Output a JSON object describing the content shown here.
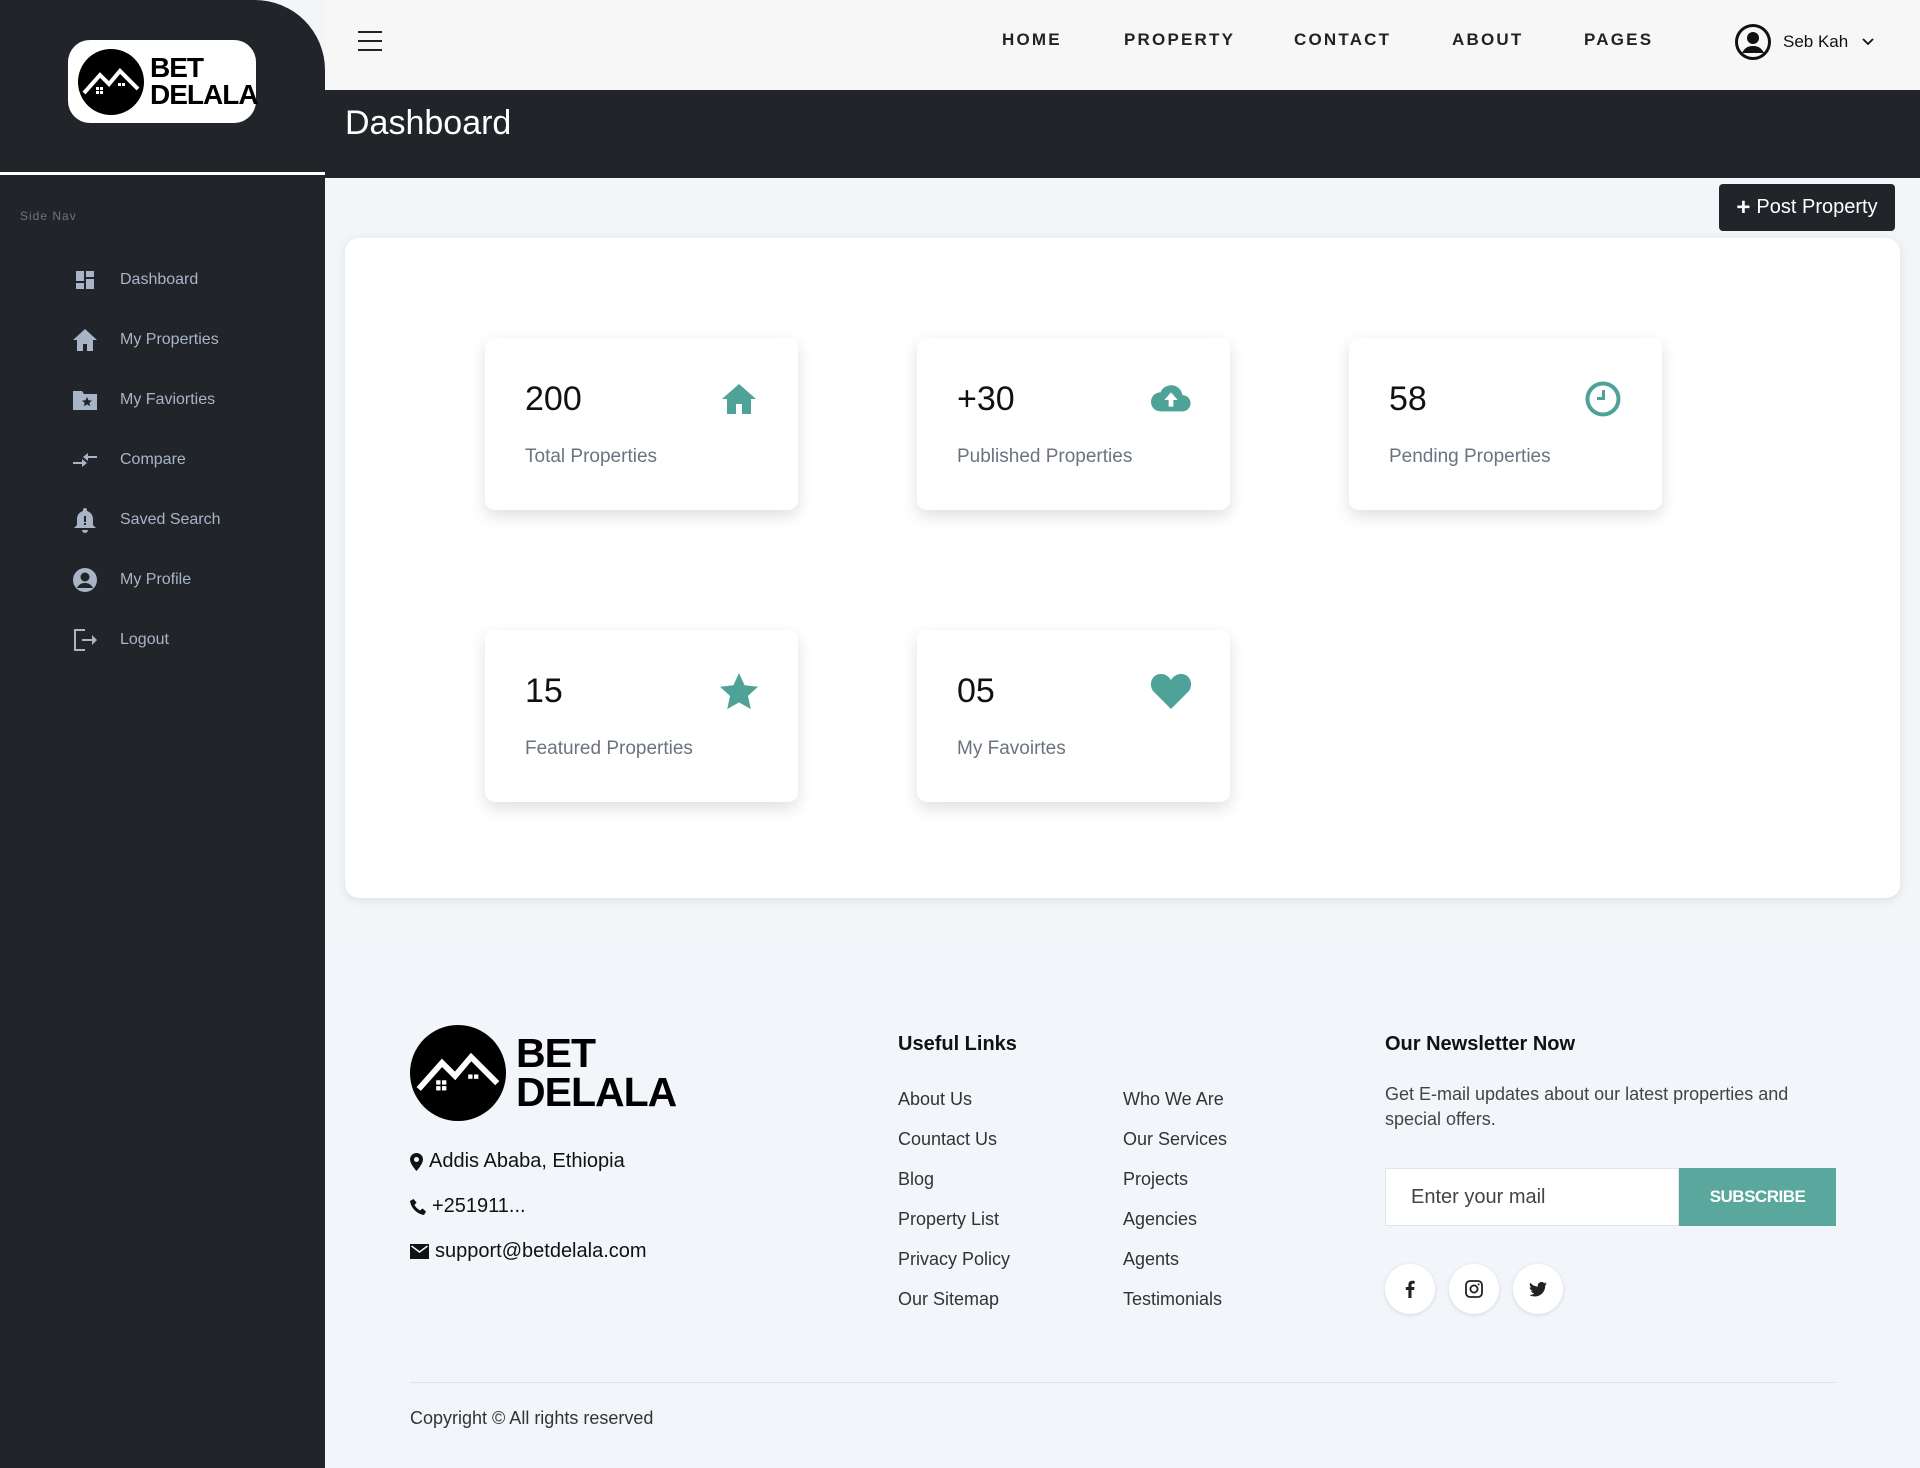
{
  "brand": {
    "line1": "BET",
    "line2": "DELALA"
  },
  "sidebar": {
    "section_label": "Side Nav",
    "items": [
      {
        "label": "Dashboard",
        "icon": "dashboard-icon"
      },
      {
        "label": "My Properties",
        "icon": "home-icon"
      },
      {
        "label": "My Faviorties",
        "icon": "favorite-folder-icon"
      },
      {
        "label": "Compare",
        "icon": "compare-arrows-icon"
      },
      {
        "label": "Saved Search",
        "icon": "bell-icon"
      },
      {
        "label": "My Profile",
        "icon": "user-circle-icon"
      },
      {
        "label": "Logout",
        "icon": "logout-icon"
      }
    ]
  },
  "topnav": {
    "links": [
      "HOME",
      "PROPERTY",
      "CONTACT",
      "ABOUT",
      "PAGES"
    ],
    "user_name": "Seb Kah"
  },
  "page": {
    "title": "Dashboard",
    "post_button": "Post Property"
  },
  "stats": [
    {
      "value": "200",
      "label": "Total Properties",
      "icon": "home-icon"
    },
    {
      "value": "+30",
      "label": "Published Properties",
      "icon": "cloud-upload-icon"
    },
    {
      "value": "58",
      "label": "Pending Properties",
      "icon": "clock-icon"
    },
    {
      "value": "15",
      "label": "Featured Properties",
      "icon": "star-icon"
    },
    {
      "value": "05",
      "label": "My Favoirtes",
      "icon": "heart-icon"
    }
  ],
  "footer": {
    "address": "Addis Ababa, Ethiopia",
    "phone": "+251911...",
    "email": "support@betdelala.com",
    "links_heading": "Useful Links",
    "links_col1": [
      "About Us",
      "Countact Us",
      "Blog",
      "Property List",
      "Privacy Policy",
      "Our Sitemap"
    ],
    "links_col2": [
      "Who We Are",
      "Our Services",
      "Projects",
      "Agencies",
      "Agents",
      "Testimonials"
    ],
    "newsletter_heading": "Our Newsletter Now",
    "newsletter_text": "Get E-mail updates about our latest properties and special offers.",
    "email_placeholder": "Enter your mail",
    "subscribe_label": "SUBSCRIBE",
    "socials": [
      "facebook-icon",
      "instagram-icon",
      "twitter-icon"
    ],
    "copyright": "Copyright © All rights reserved"
  },
  "colors": {
    "accent": "#4fa298",
    "sidebar_bg": "#212529",
    "subscribe_bg": "#5aa79d"
  }
}
